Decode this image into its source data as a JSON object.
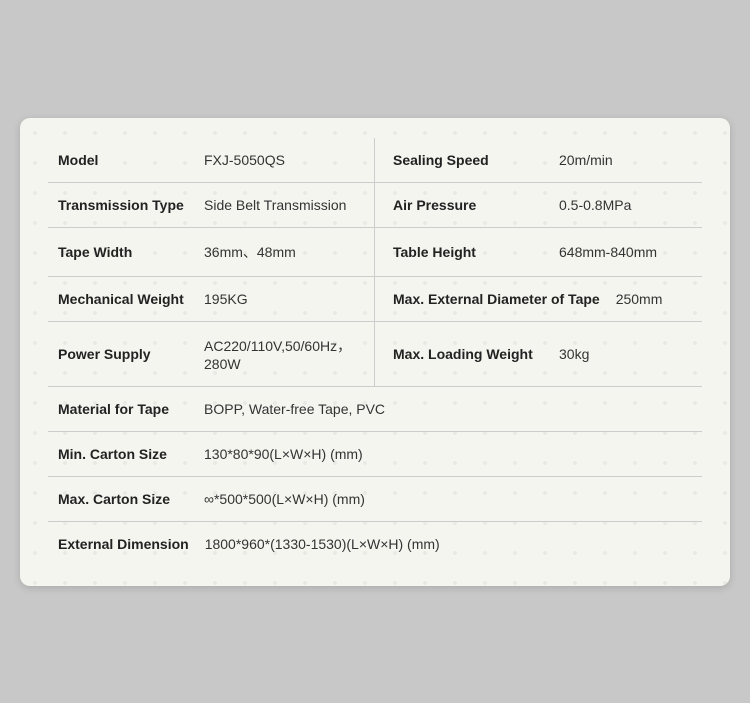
{
  "rows": [
    {
      "type": "two",
      "left": {
        "label": "Model",
        "value": "FXJ-5050QS"
      },
      "right": {
        "label": "Sealing Speed",
        "value": "20m/min"
      }
    },
    {
      "type": "two",
      "left": {
        "label": "Transmission Type",
        "value": "Side Belt Transmission"
      },
      "right": {
        "label": "Air Pressure",
        "value": "0.5-0.8MPa"
      }
    },
    {
      "type": "two",
      "left": {
        "label": "Tape Width",
        "value": "36mm、48mm"
      },
      "right": {
        "label": "Table Height",
        "value": "648mm-840mm"
      }
    },
    {
      "type": "two",
      "left": {
        "label": "Mechanical Weight",
        "value": "195KG"
      },
      "right": {
        "label": "Max. External Diameter of Tape",
        "value": "250mm"
      }
    },
    {
      "type": "two",
      "left": {
        "label": "Power Supply",
        "value": "AC220/110V,50/60Hz，280W"
      },
      "right": {
        "label": "Max. Loading Weight",
        "value": "30kg"
      }
    },
    {
      "type": "full",
      "label": "Material for Tape",
      "value": "BOPP, Water-free Tape, PVC"
    },
    {
      "type": "full",
      "label": "Min. Carton Size",
      "value": "130*80*90(L×W×H) (mm)"
    },
    {
      "type": "full",
      "label": "Max. Carton Size",
      "value": "∞*500*500(L×W×H) (mm)"
    },
    {
      "type": "full",
      "label": "External Dimension",
      "value": "1800*960*(1330-1530)(L×W×H) (mm)"
    }
  ]
}
